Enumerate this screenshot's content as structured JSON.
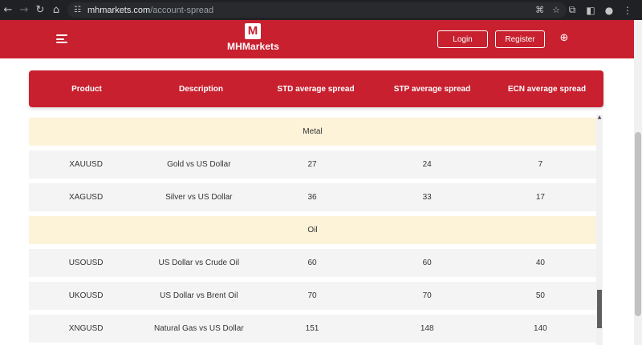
{
  "browser": {
    "url_host": "mhmarkets.com",
    "url_path": "/account-spread"
  },
  "header": {
    "logo_mark": "M",
    "logo_text": "MHMarkets",
    "login_label": "Login",
    "register_label": "Register"
  },
  "table": {
    "headers": [
      "Product",
      "Description",
      "STD average spread",
      "STP average spread",
      "ECN average spread"
    ],
    "sections": [
      {
        "name": "Metal",
        "rows": [
          {
            "product": "XAUUSD",
            "description": "Gold vs US Dollar",
            "std": "27",
            "stp": "24",
            "ecn": "7"
          },
          {
            "product": "XAGUSD",
            "description": "Silver vs US Dollar",
            "std": "36",
            "stp": "33",
            "ecn": "17"
          }
        ]
      },
      {
        "name": "Oil",
        "rows": [
          {
            "product": "USOUSD",
            "description": "US Dollar vs Crude Oil",
            "std": "60",
            "stp": "60",
            "ecn": "40"
          },
          {
            "product": "UKOUSD",
            "description": "US Dollar vs Brent Oil",
            "std": "70",
            "stp": "70",
            "ecn": "50"
          },
          {
            "product": "XNGUSD",
            "description": "Natural Gas vs US Dollar",
            "std": "151",
            "stp": "148",
            "ecn": "140"
          }
        ]
      }
    ]
  }
}
